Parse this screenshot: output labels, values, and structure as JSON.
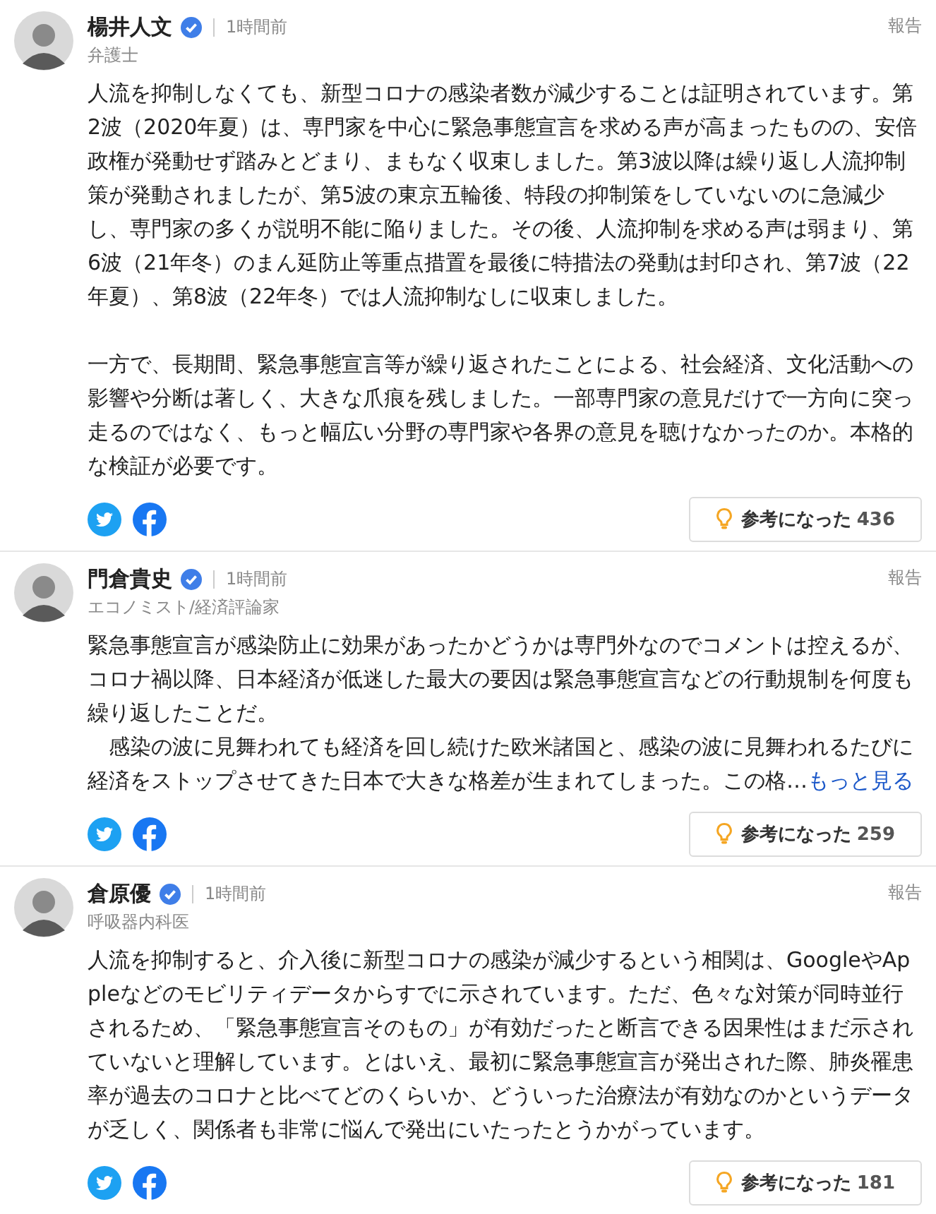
{
  "comments": [
    {
      "name": "楊井人文",
      "verified": true,
      "time": "1時間前",
      "title": "弁護士",
      "report": "報告",
      "paragraph_gap": true,
      "body": [
        "人流を抑制しなくても、新型コロナの感染者数が減少することは証明されています。第2波（2020年夏）は、専門家を中心に緊急事態宣言を求める声が高まったものの、安倍政権が発動せず踏みとどまり、まもなく収束しました。第3波以降は繰り返し人流抑制策が発動されましたが、第5波の東京五輪後、特段の抑制策をしていないのに急減少し、専門家の多くが説明不能に陥りました。その後、人流抑制を求める声は弱まり、第6波（21年冬）のまん延防止等重点措置を最後に特措法の発動は封印され、第7波（22年夏）、第8波（22年冬）では人流抑制なしに収束しました。",
        "一方で、長期間、緊急事態宣言等が繰り返されたことによる、社会経済、文化活動への影響や分断は著しく、大きな爪痕を残しました。一部専門家の意見だけで一方向に突っ走るのではなく、もっと幅広い分野の専門家や各界の意見を聴けなかったのか。本格的な検証が必要です。"
      ],
      "helpful_label": "参考になった",
      "helpful_count": "436"
    },
    {
      "name": "門倉貴史",
      "verified": true,
      "time": "1時間前",
      "title": "エコノミスト/経済評論家",
      "report": "報告",
      "paragraph_gap": false,
      "body": [
        "緊急事態宣言が感染防止に効果があったかどうかは専門外なのでコメントは控えるが、コロナ禍以降、日本経済が低迷した最大の要因は緊急事態宣言などの行動規制を何度も繰り返したことだ。",
        "　感染の波に見舞われても経済を回し続けた欧米諸国と、感染の波に見舞われるたびに経済をストップさせてきた日本で大きな格差が生まれてしまった。この格…"
      ],
      "more": "もっと見る",
      "helpful_label": "参考になった",
      "helpful_count": "259"
    },
    {
      "name": "倉原優",
      "verified": true,
      "time": "1時間前",
      "title": "呼吸器内科医",
      "report": "報告",
      "paragraph_gap": false,
      "body": [
        "人流を抑制すると、介入後に新型コロナの感染が減少するという相関は、GoogleやAppleなどのモビリティデータからすでに示されています。ただ、色々な対策が同時並行されるため、「緊急事態宣言そのもの」が有効だったと断言できる因果性はまだ示されていないと理解しています。とはいえ、最初に緊急事態宣言が発出された際、肺炎罹患率が過去のコロナと比べてどのくらいか、どういった治療法が有効なのかというデータが乏しく、関係者も非常に悩んで発出にいたったとうかがっています。"
      ],
      "helpful_label": "参考になった",
      "helpful_count": "181"
    }
  ]
}
